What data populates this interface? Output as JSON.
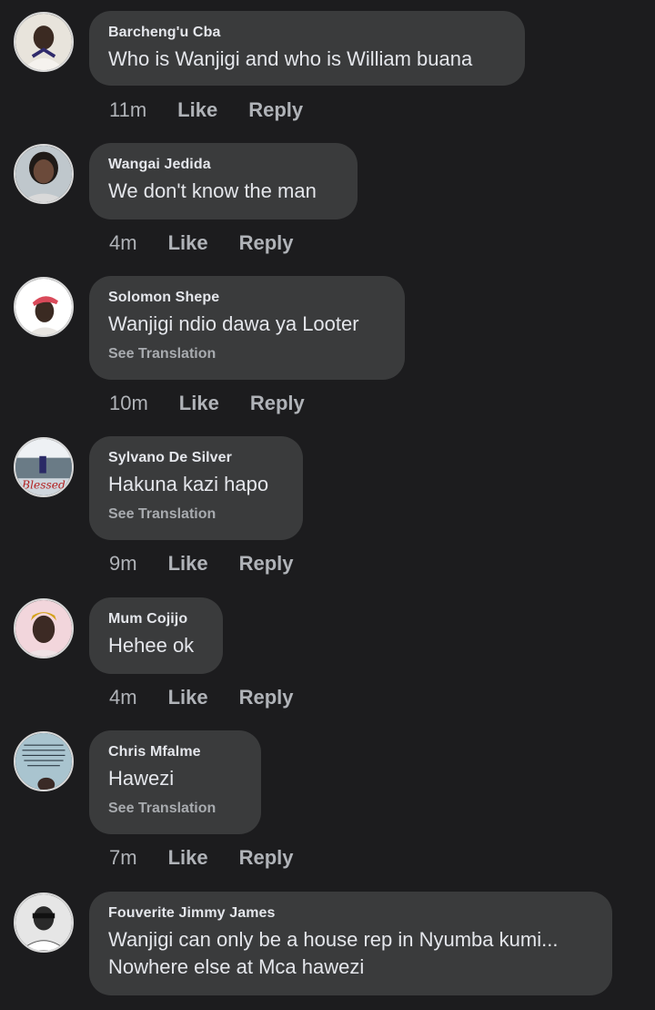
{
  "comments": [
    {
      "author": "Barcheng'u Cba",
      "text": "Who is Wanjigi and who is William buana",
      "time": "11m",
      "like": "Like",
      "reply": "Reply"
    },
    {
      "author": "Wangai Jedida",
      "text": "We don't know the man",
      "time": "4m",
      "like": "Like",
      "reply": "Reply"
    },
    {
      "author": "Solomon Shepe",
      "text": "Wanjigi ndio dawa ya Looter",
      "translation": "See Translation",
      "time": "10m",
      "like": "Like",
      "reply": "Reply"
    },
    {
      "author": "Sylvano De Silver",
      "text": "Hakuna kazi hapo",
      "translation": "See Translation",
      "time": "9m",
      "like": "Like",
      "reply": "Reply",
      "avatar_caption": "Blessed"
    },
    {
      "author": "Mum Cojijo",
      "text": "Hehee ok",
      "time": "4m",
      "like": "Like",
      "reply": "Reply"
    },
    {
      "author": "Chris Mfalme",
      "text": "Hawezi",
      "translation": "See Translation",
      "time": "7m",
      "like": "Like",
      "reply": "Reply"
    },
    {
      "author": "Fouverite Jimmy James",
      "text_line1": "Wanjigi can only be a house rep in Nyumba kumi...",
      "text_line2": "Nowhere else at Mca hawezi"
    }
  ],
  "colors": {
    "background": "#1c1c1e",
    "bubble": "#3a3b3c",
    "text": "#e4e6eb",
    "muted": "#b0b3b8"
  }
}
